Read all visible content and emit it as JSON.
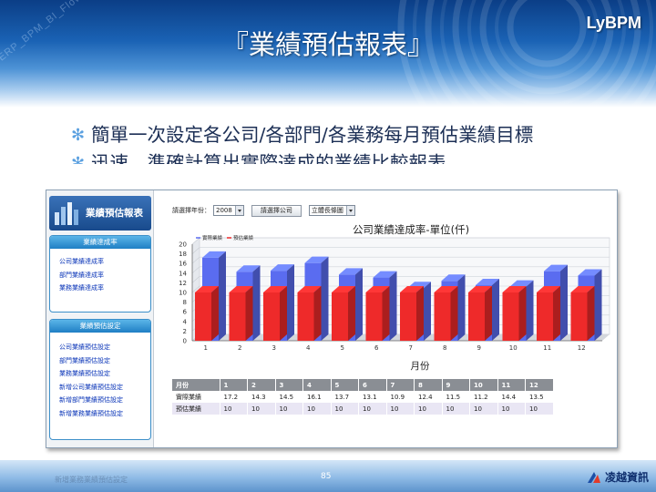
{
  "slide": {
    "title": "『業績預估報表』",
    "brand": "LyBPM",
    "watermark": "ERP_BPM_BI_Flow",
    "bullets": [
      "簡單一次設定各公司/各部門/各業務每月預估業績目標",
      "迅速、準確計算出實際達成的業績比較報表"
    ],
    "page_number": "85",
    "footer_logo_text": "凌越資訊",
    "footer_ghost_text": "新增業務業績預估設定"
  },
  "app": {
    "logo_label": "業績預估報表",
    "menus": [
      {
        "heading": "業績達成率",
        "items": [
          "公司業績達成率",
          "部門業績達成率",
          "業務業績達成率"
        ]
      },
      {
        "heading": "業績預估設定",
        "items": [
          "公司業績預估設定",
          "部門業績預估設定",
          "業務業績預估設定",
          "新增公司業績預估設定",
          "新增部門業績預估設定",
          "新增業務業績預估設定"
        ]
      }
    ],
    "filter": {
      "year_label": "請選擇年份：",
      "year_value": "2008",
      "company_button": "請選擇公司",
      "chart_type_value": "立體長條圖"
    },
    "table": {
      "row_header": "月份",
      "actual_label": "實際業績",
      "forecast_label": "預估業績"
    }
  },
  "chart_data": {
    "type": "bar",
    "title": "公司業績達成率-單位(仟)",
    "xlabel": "月份",
    "ylabel": "",
    "categories": [
      "1",
      "2",
      "3",
      "4",
      "5",
      "6",
      "7",
      "8",
      "9",
      "10",
      "11",
      "12"
    ],
    "series": [
      {
        "name": "實際業績",
        "values": [
          17.2,
          14.3,
          14.5,
          16.1,
          13.7,
          13.1,
          10.9,
          12.4,
          11.5,
          11.2,
          14.4,
          13.5
        ],
        "color": "#5a6cf0"
      },
      {
        "name": "預估業績",
        "values": [
          10,
          10,
          10,
          10,
          10,
          10,
          10,
          10,
          10,
          10,
          10,
          10
        ],
        "color": "#ee2a2a"
      }
    ],
    "ylim": [
      0,
      20
    ],
    "yticks": [
      0,
      2,
      4,
      6,
      8,
      10,
      12,
      14,
      16,
      18,
      20
    ],
    "legend": "top-left",
    "grid": true,
    "style": "3d-bar"
  }
}
